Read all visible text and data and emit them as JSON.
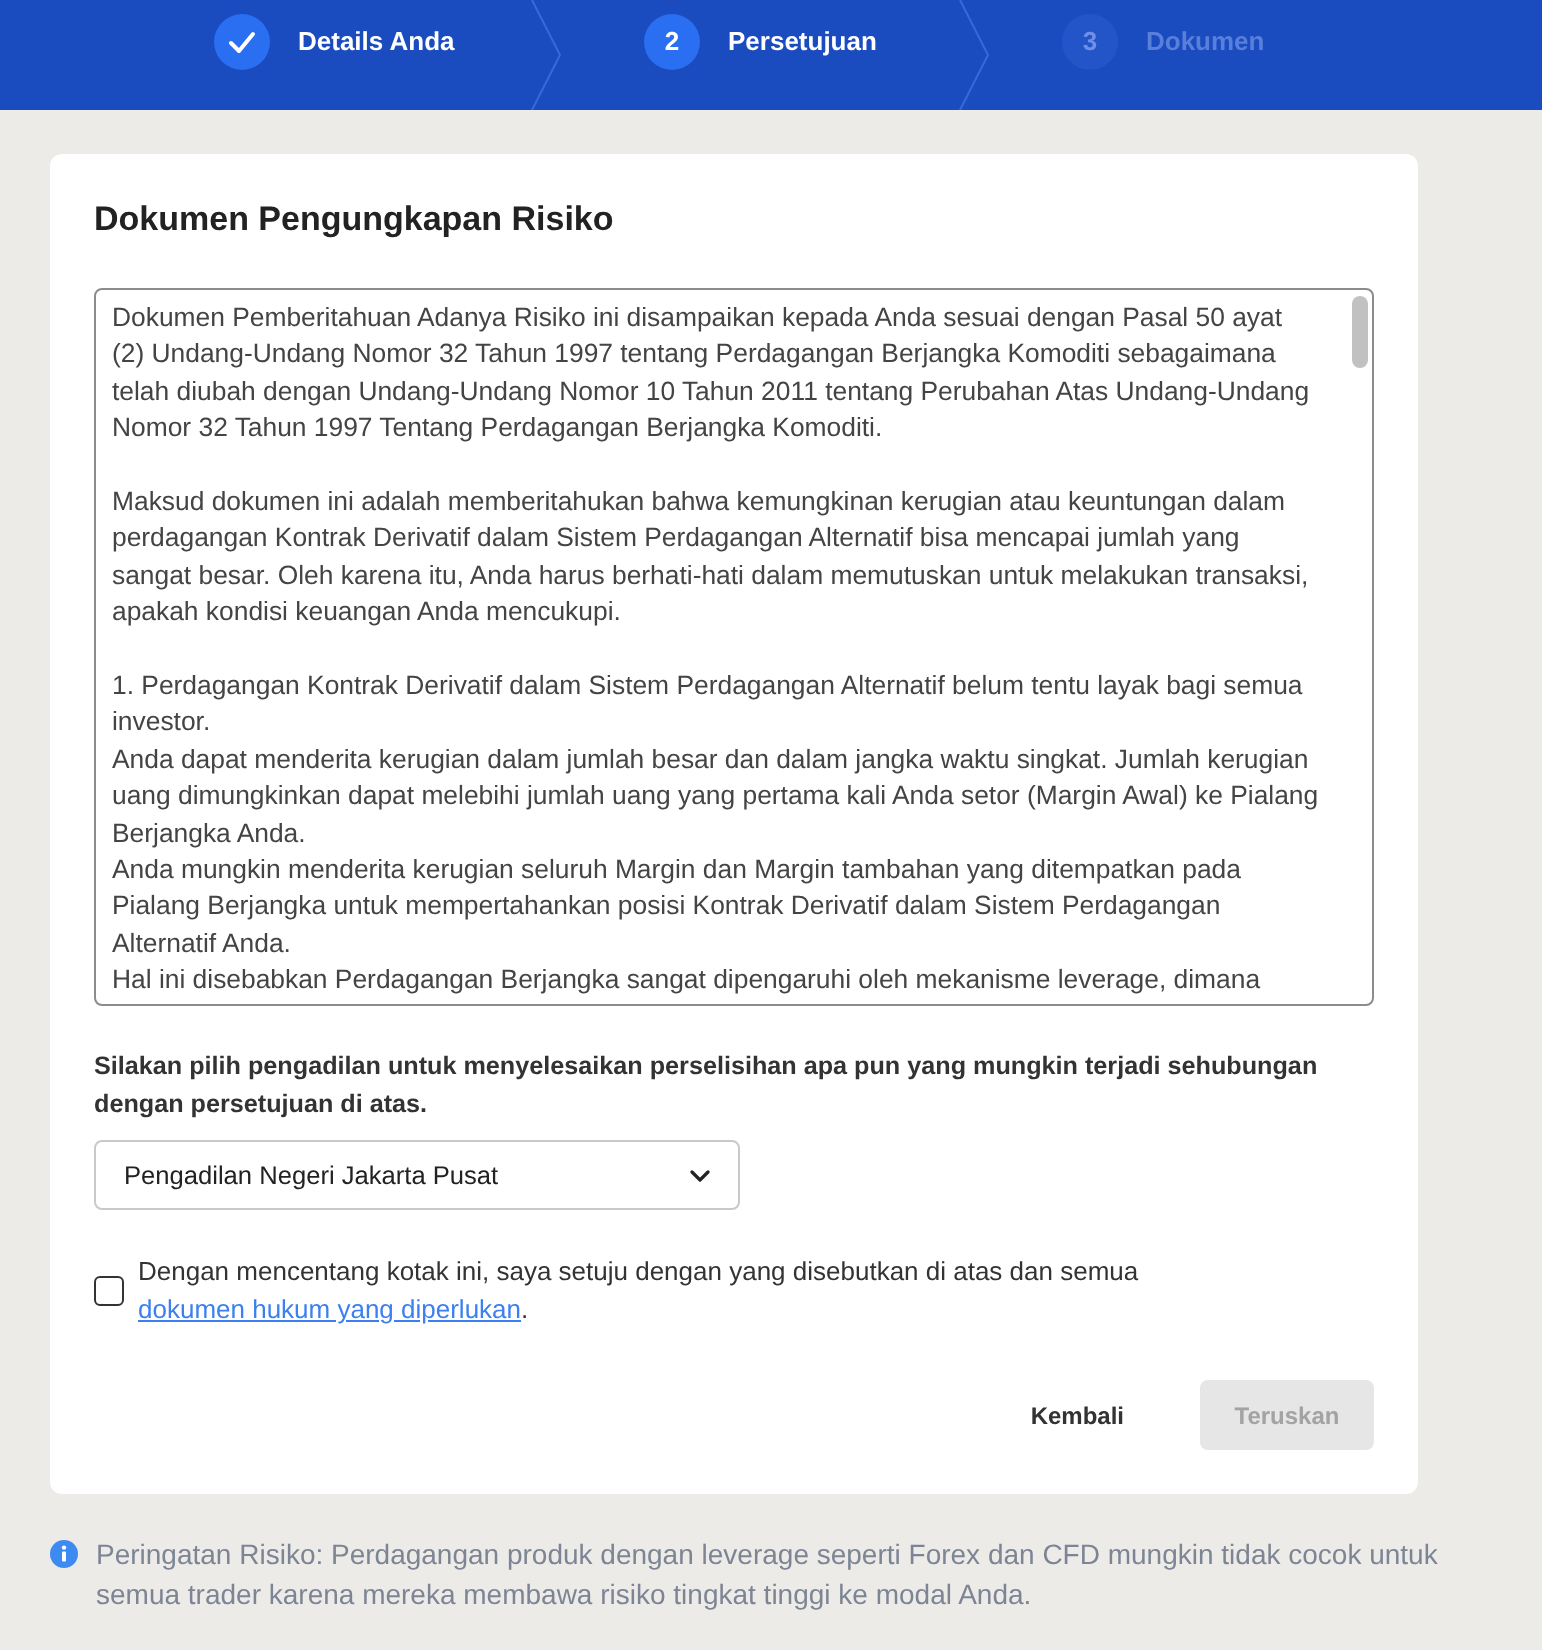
{
  "steps": [
    {
      "label": "Details Anda",
      "completed": true,
      "disabled": false
    },
    {
      "number": "2",
      "label": "Persetujuan",
      "completed": false,
      "disabled": false
    },
    {
      "number": "3",
      "label": "Dokumen",
      "completed": false,
      "disabled": true
    }
  ],
  "card": {
    "title": "Dokumen Pengungkapan Risiko",
    "document": {
      "sections": [
        {
          "paragraphs": [
            "Dokumen Pemberitahuan Adanya Risiko ini disampaikan kepada Anda sesuai dengan Pasal 50 ayat (2) Undang-Undang Nomor 32 Tahun 1997 tentang Perdagangan Berjangka Komoditi sebagaimana telah diubah dengan Undang-Undang Nomor 10 Tahun 2011 tentang Perubahan Atas Undang-Undang Nomor 32 Tahun 1997 Tentang Perdagangan Berjangka Komoditi."
          ]
        },
        {
          "paragraphs": [
            "Maksud dokumen ini adalah memberitahukan bahwa kemungkinan kerugian atau keuntungan dalam perdagangan Kontrak Derivatif dalam Sistem Perdagangan Alternatif bisa mencapai jumlah yang sangat besar. Oleh karena itu, Anda harus berhati-hati dalam memutuskan untuk melakukan transaksi, apakah kondisi keuangan Anda mencukupi."
          ]
        },
        {
          "paragraphs": [
            "1. Perdagangan Kontrak Derivatif dalam Sistem Perdagangan Alternatif belum tentu layak bagi semua investor.",
            "Anda dapat menderita kerugian dalam jumlah besar dan dalam jangka waktu singkat. Jumlah kerugian uang dimungkinkan dapat melebihi jumlah uang yang pertama kali Anda setor (Margin Awal) ke Pialang Berjangka Anda.",
            "Anda mungkin menderita kerugian seluruh Margin dan Margin tambahan yang ditempatkan pada Pialang Berjangka untuk mempertahankan posisi Kontrak Derivatif dalam Sistem Perdagangan Alternatif Anda.",
            "Hal ini disebabkan Perdagangan Berjangka sangat dipengaruhi oleh mekanisme leverage, dimana"
          ]
        }
      ]
    },
    "court_prompt": "Silakan pilih pengadilan untuk menyelesaikan perselisihan apa pun yang mungkin terjadi sehubungan dengan persetujuan di atas.",
    "court_select": {
      "value": "Pengadilan Negeri Jakarta Pusat"
    },
    "agreement": {
      "checked": false,
      "text": "Dengan mencentang kotak ini, saya setuju dengan yang disebutkan di atas dan semua",
      "link": "dokumen hukum yang diperlukan",
      "end": "."
    },
    "buttons": [
      {
        "label": "Kembali",
        "kind": "text",
        "disabled": false
      },
      {
        "label": "Teruskan",
        "kind": "filled",
        "disabled": true
      }
    ]
  },
  "risk_warning": "Peringatan Risiko: Perdagangan produk dengan leverage seperti Forex dan CFD mungkin tidak cocok untuk semua trader karena mereka membawa risiko tingkat tinggi ke modal Anda."
}
